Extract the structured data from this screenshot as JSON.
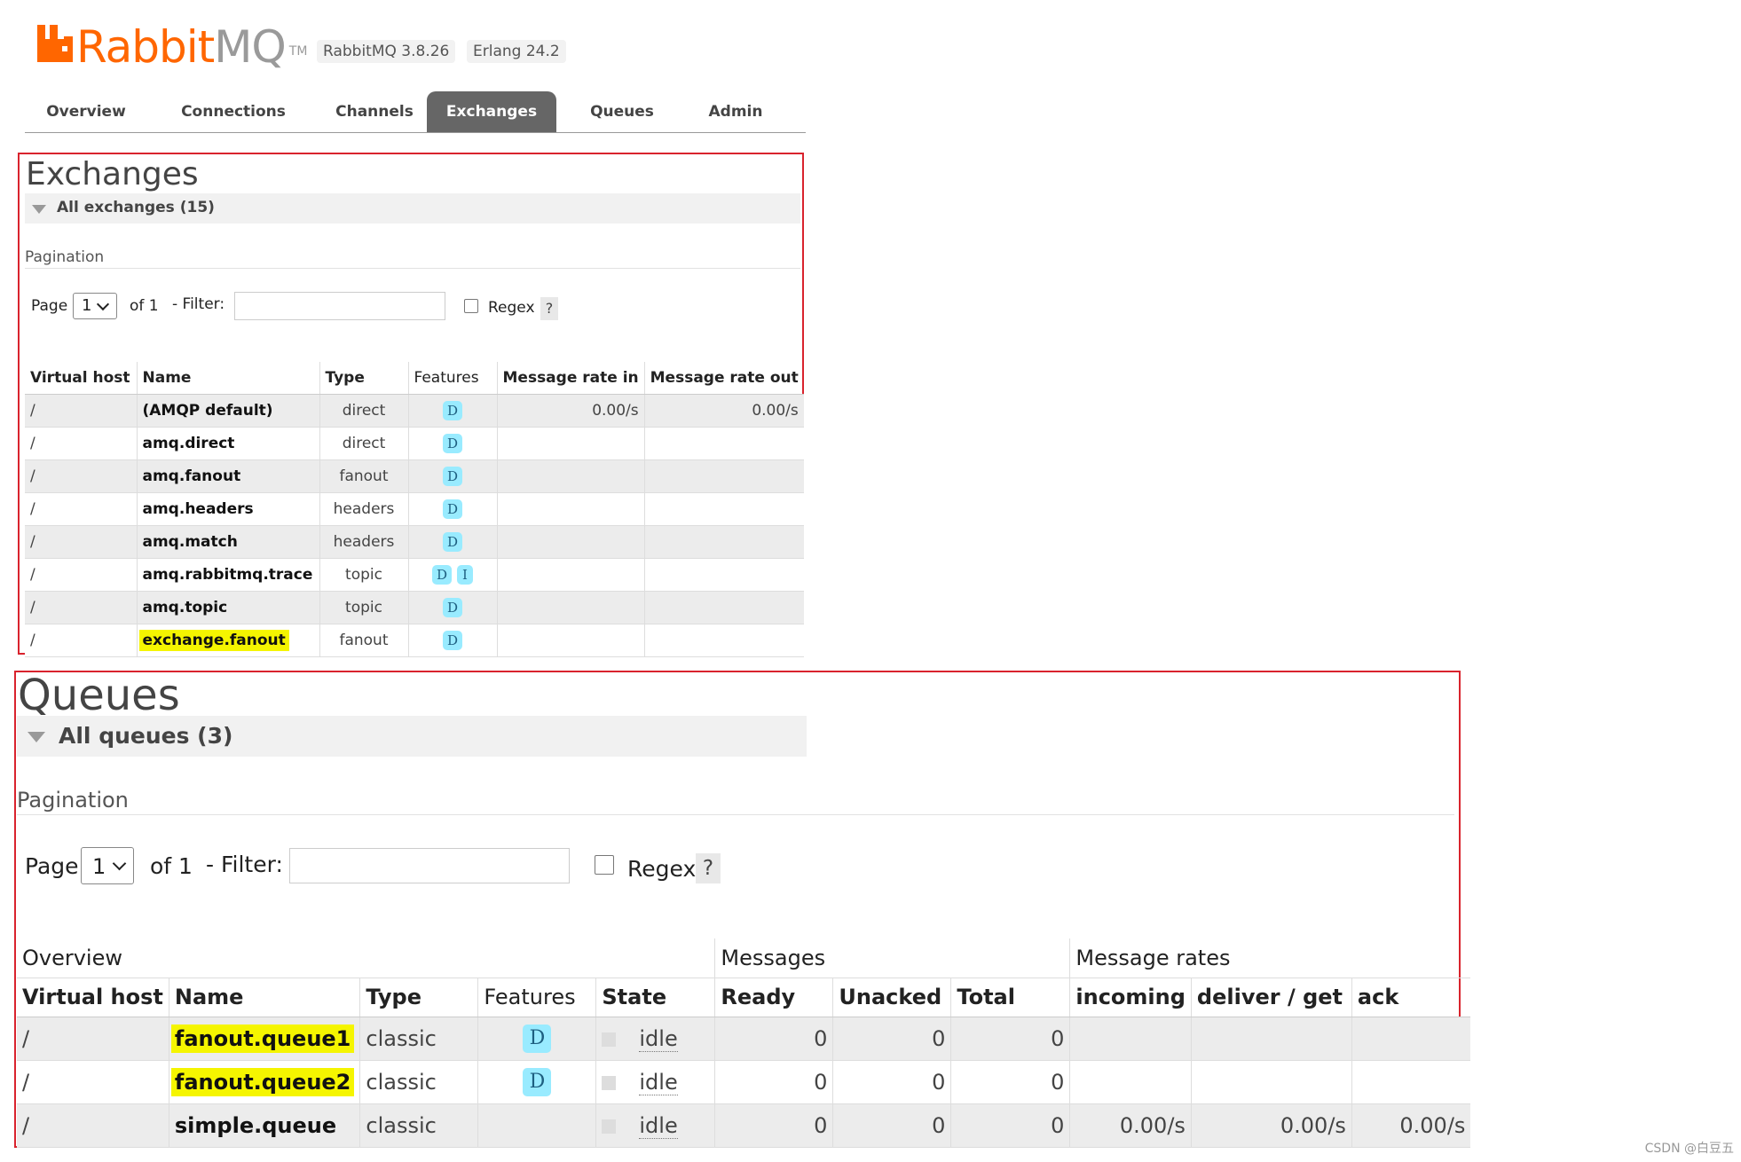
{
  "header": {
    "logo_prefix": "Rabbit",
    "logo_suffix": "MQ",
    "logo_tm": "TM",
    "rabbitmq_version": "RabbitMQ 3.8.26",
    "erlang_version": "Erlang 24.2"
  },
  "nav": {
    "tabs": [
      {
        "label": "Overview"
      },
      {
        "label": "Connections"
      },
      {
        "label": "Channels"
      },
      {
        "label": "Exchanges",
        "active": true
      },
      {
        "label": "Queues"
      },
      {
        "label": "Admin"
      }
    ]
  },
  "exchanges": {
    "title": "Exchanges",
    "section_label": "All exchanges (15)",
    "pagination_label": "Pagination",
    "page_label": "Page",
    "page_value": "1",
    "of_label": "of 1",
    "filter_label": "- Filter:",
    "filter_value": "",
    "regex_label": "Regex",
    "help_label": "?",
    "columns": [
      "Virtual host",
      "Name",
      "Type",
      "Features",
      "Message rate in",
      "Message rate out"
    ],
    "rows": [
      {
        "vhost": "/",
        "name": "(AMQP default)",
        "type": "direct",
        "features": [
          "D"
        ],
        "rate_in": "0.00/s",
        "rate_out": "0.00/s"
      },
      {
        "vhost": "/",
        "name": "amq.direct",
        "type": "direct",
        "features": [
          "D"
        ],
        "rate_in": "",
        "rate_out": ""
      },
      {
        "vhost": "/",
        "name": "amq.fanout",
        "type": "fanout",
        "features": [
          "D"
        ],
        "rate_in": "",
        "rate_out": ""
      },
      {
        "vhost": "/",
        "name": "amq.headers",
        "type": "headers",
        "features": [
          "D"
        ],
        "rate_in": "",
        "rate_out": ""
      },
      {
        "vhost": "/",
        "name": "amq.match",
        "type": "headers",
        "features": [
          "D"
        ],
        "rate_in": "",
        "rate_out": ""
      },
      {
        "vhost": "/",
        "name": "amq.rabbitmq.trace",
        "type": "topic",
        "features": [
          "D",
          "I"
        ],
        "rate_in": "",
        "rate_out": ""
      },
      {
        "vhost": "/",
        "name": "amq.topic",
        "type": "topic",
        "features": [
          "D"
        ],
        "rate_in": "",
        "rate_out": ""
      },
      {
        "vhost": "/",
        "name": "exchange.fanout",
        "type": "fanout",
        "features": [
          "D"
        ],
        "rate_in": "",
        "rate_out": "",
        "highlighted": true
      }
    ]
  },
  "queues": {
    "title": "Queues",
    "section_label": "All queues (3)",
    "pagination_label": "Pagination",
    "page_label": "Page",
    "page_value": "1",
    "of_label": "of 1",
    "filter_label": "- Filter:",
    "filter_value": "",
    "regex_label": "Regex",
    "help_label": "?",
    "group_headers": [
      "Overview",
      "Messages",
      "Message rates"
    ],
    "columns": [
      "Virtual host",
      "Name",
      "Type",
      "Features",
      "State",
      "Ready",
      "Unacked",
      "Total",
      "incoming",
      "deliver / get",
      "ack"
    ],
    "rows": [
      {
        "vhost": "/",
        "name": "fanout.queue1",
        "type": "classic",
        "features": [
          "D"
        ],
        "state": "idle",
        "ready": "0",
        "unacked": "0",
        "total": "0",
        "incoming": "",
        "deliver_get": "",
        "ack": "",
        "highlighted": true
      },
      {
        "vhost": "/",
        "name": "fanout.queue2",
        "type": "classic",
        "features": [
          "D"
        ],
        "state": "idle",
        "ready": "0",
        "unacked": "0",
        "total": "0",
        "incoming": "",
        "deliver_get": "",
        "ack": "",
        "highlighted": true
      },
      {
        "vhost": "/",
        "name": "simple.queue",
        "type": "classic",
        "features": [],
        "state": "idle",
        "ready": "0",
        "unacked": "0",
        "total": "0",
        "incoming": "0.00/s",
        "deliver_get": "0.00/s",
        "ack": "0.00/s"
      }
    ]
  },
  "watermark": "CSDN @白豆五",
  "colors": {
    "brand_orange": "#ff6600",
    "active_tab": "#666666",
    "highlight_box": "#d9232d",
    "feature_badge": "#99ebff",
    "name_highlight": "#f5f500"
  }
}
